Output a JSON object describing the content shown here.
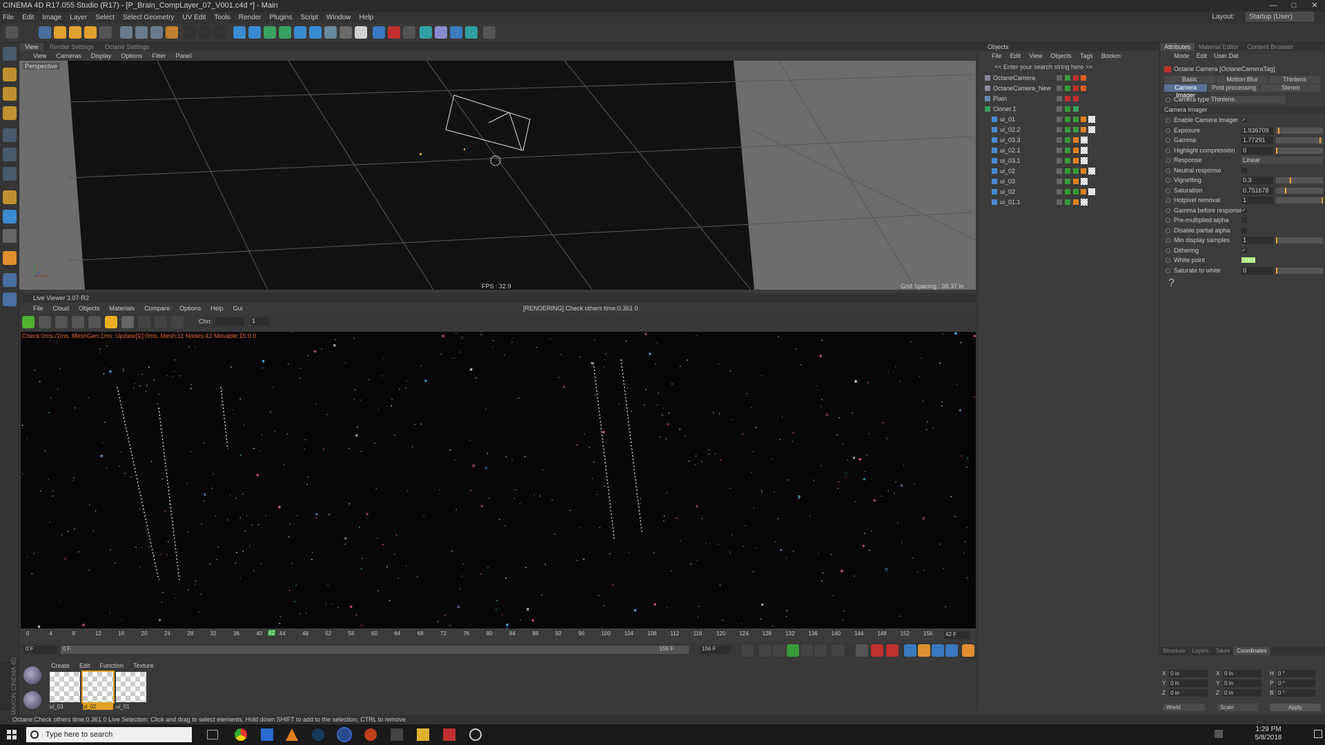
{
  "window": {
    "title": "CINEMA 4D R17.055 Studio (R17) - [P_Brain_CompLayer_07_V001.c4d *] - Main",
    "controls": [
      "—",
      "□",
      "✕"
    ]
  },
  "menubar": {
    "items": [
      "File",
      "Edit",
      "Image",
      "Layer",
      "Select",
      "Select Geometry",
      "UV Edit",
      "Tools",
      "Render",
      "Plugins",
      "Script",
      "Window",
      "Help"
    ],
    "layout_label": "Layout:",
    "layout_value": "Startup (User)"
  },
  "viewport": {
    "tabs": [
      "View",
      "Render Settings",
      "Octane Settings"
    ],
    "menu": [
      "View",
      "Cameras",
      "Display",
      "Options",
      "Filter",
      "Panel"
    ],
    "label": "Perspective",
    "fps": "FPS : 32.9",
    "grid_spacing": "Grid Spacing : 39.37 in"
  },
  "live_viewer": {
    "title": "Live Viewer 3.07-R2",
    "menu": [
      "File",
      "Cloud",
      "Objects",
      "Materials",
      "Compare",
      "Options",
      "Help",
      "Gui"
    ],
    "status": "[RENDERING] Check others time:0.361  0",
    "chn_label": "Chn:",
    "chn_num": "1",
    "stats": "Check:0ms./1ms. MeshGen:1ms. Update[C]:0ms. Mesh:11 Nodes:42 Movable:15  0 0"
  },
  "timeline": {
    "ticks": [
      "0",
      "4",
      "8",
      "12",
      "16",
      "20",
      "24",
      "28",
      "32",
      "36",
      "40",
      "44",
      "48",
      "52",
      "56",
      "60",
      "64",
      "68",
      "72",
      "76",
      "80",
      "84",
      "88",
      "92",
      "96",
      "100",
      "104",
      "108",
      "112",
      "116",
      "120",
      "124",
      "128",
      "132",
      "136",
      "140",
      "144",
      "148",
      "152",
      "156"
    ],
    "current_marker": "42",
    "end_label": "42 F",
    "start_field": "0 F",
    "mid_field": "0 F",
    "end_field": "156 F",
    "end_field2": "156 F"
  },
  "materials": {
    "menu": [
      "Create",
      "Edit",
      "Function",
      "Texture"
    ],
    "items": [
      "ui_03",
      "ui_02",
      "ui_01"
    ]
  },
  "objects": {
    "title": "Objects",
    "menu": [
      "File",
      "Edit",
      "View",
      "Objects",
      "Tags",
      "Bookm"
    ],
    "search_placeholder": "<< Enter your search string here >>",
    "rows": [
      {
        "name": "OctaneCamera",
        "indent": 0
      },
      {
        "name": "OctaneCamera_New",
        "indent": 0
      },
      {
        "name": "Plain",
        "indent": 0
      },
      {
        "name": "Cloner.1",
        "indent": 0
      },
      {
        "name": "ui_01",
        "indent": 1
      },
      {
        "name": "ui_02.2",
        "indent": 1
      },
      {
        "name": "ui_03.3",
        "indent": 1
      },
      {
        "name": "ui_02.1",
        "indent": 1
      },
      {
        "name": "ui_03.1",
        "indent": 1
      },
      {
        "name": "ui_02",
        "indent": 1
      },
      {
        "name": "ui_03",
        "indent": 1
      },
      {
        "name": "ui_02",
        "indent": 1
      },
      {
        "name": "ui_01.1",
        "indent": 1
      }
    ]
  },
  "attributes": {
    "tabs": [
      "Attributes",
      "Material Editor",
      "Content Browser"
    ],
    "menu": [
      "Mode",
      "Edit",
      "User Dat"
    ],
    "object_title": "Octane Camera [OctaneCameraTag]",
    "buttons_row1": [
      "Basic",
      "Motion Blur",
      "Thinlens"
    ],
    "buttons_row2": [
      "Camera Imager",
      "Post processing",
      "Stereo"
    ],
    "camera_type_label": "Camera type",
    "camera_type_value": "Thinlens",
    "section": "Camera Imager",
    "rows": [
      {
        "label": "Enable Camera Imager",
        "type": "check",
        "value": "✓"
      },
      {
        "label": "Exposure",
        "type": "num",
        "value": "1.936709",
        "bar": 0.05
      },
      {
        "label": "Gamma",
        "type": "num",
        "value": "1.77291",
        "bar": 0.95
      },
      {
        "label": "Highlight compression",
        "type": "num",
        "value": "0",
        "bar": 0.0
      },
      {
        "label": "Response",
        "type": "sel",
        "value": "Linear"
      },
      {
        "label": "Neutral response",
        "type": "check",
        "value": ""
      },
      {
        "label": "Vignetting",
        "type": "num",
        "value": "0.3",
        "bar": 0.3
      },
      {
        "label": "Saturation",
        "type": "num",
        "value": "0.751678",
        "bar": 0.2
      },
      {
        "label": "Hotpixel removal",
        "type": "num",
        "value": "1",
        "bar": 1.0
      },
      {
        "label": "Gamma before response",
        "type": "check",
        "value": "✓"
      },
      {
        "label": "Pre-multiplied alpha",
        "type": "check",
        "value": ""
      },
      {
        "label": "Disable partial alpha",
        "type": "check",
        "value": ""
      },
      {
        "label": "Min display samples",
        "type": "num",
        "value": "1",
        "bar": 0.0
      },
      {
        "label": "Dithering",
        "type": "check",
        "value": "✓"
      },
      {
        "label": "White point",
        "type": "color",
        "value": ""
      },
      {
        "label": "Saturate to white",
        "type": "num",
        "value": "0",
        "bar": 0.0
      }
    ],
    "help": "?"
  },
  "coords": {
    "tabs": [
      "Structure",
      "Layers",
      "Takes",
      "Coordinates"
    ],
    "rows": [
      [
        "X",
        "0 in",
        "X",
        "0 in",
        "H",
        "0 °"
      ],
      [
        "Y",
        "0 in",
        "Y",
        "0 in",
        "P",
        "0 °"
      ],
      [
        "Z",
        "0 in",
        "Z",
        "0 in",
        "B",
        "0 °"
      ]
    ],
    "world": "World",
    "scale": "Scale",
    "apply": "Apply"
  },
  "statusbar": {
    "text": "Octane:Check others time:0.361  0     Live Selection: Click and drag to select elements. Hold down SHIFT to add to the selection, CTRL to remove."
  },
  "taskbar": {
    "search_placeholder": "Type here to search",
    "time": "1:29 PM",
    "date": "5/8/2018"
  },
  "brand": "MAXON CINEMA 4D"
}
